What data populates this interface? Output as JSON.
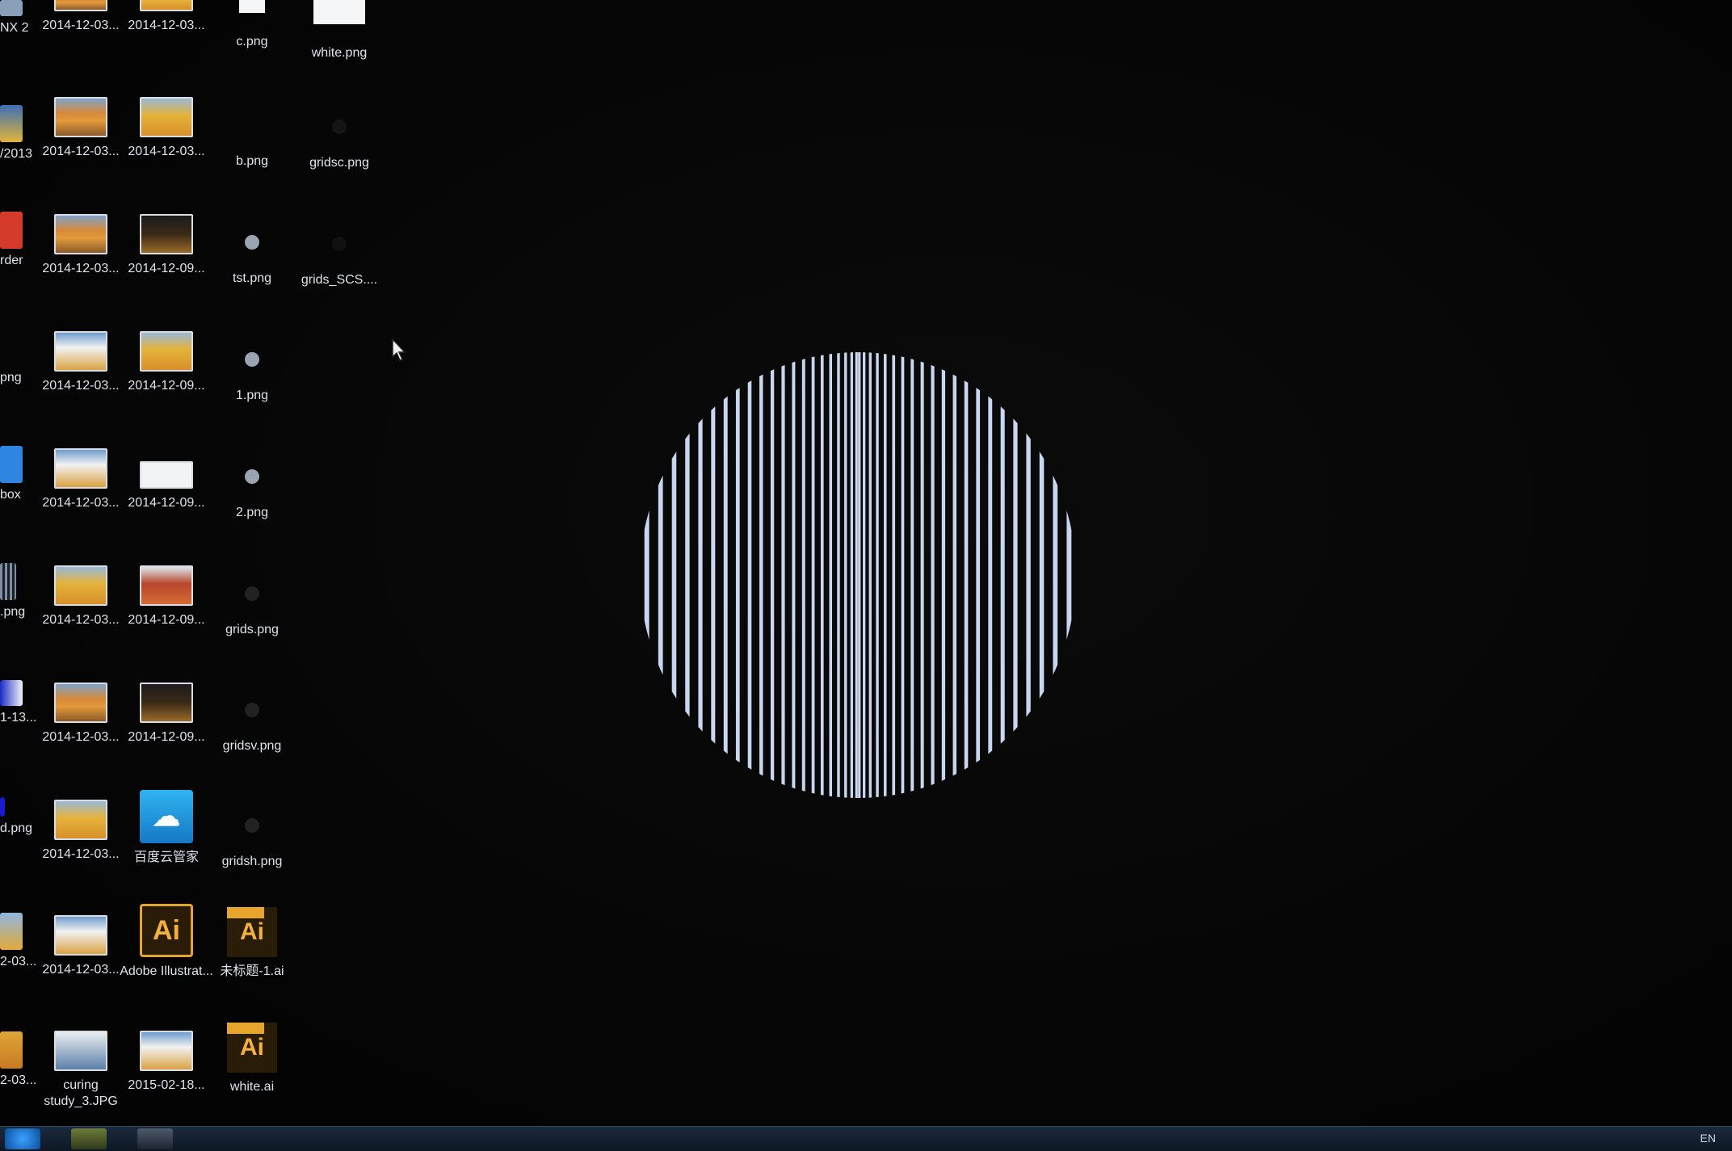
{
  "desktop": {
    "partial_column_labels": [
      "NX 2",
      "/2013",
      "rder",
      "png",
      "box",
      ".png",
      "1-13...",
      "d.png",
      "2-03...",
      "2-03..."
    ],
    "column1_labels": [
      "2014-12-03...",
      "2014-12-03...",
      "2014-12-03...",
      "2014-12-03...",
      "2014-12-03...",
      "2014-12-03...",
      "2014-12-03...",
      "2014-12-03...",
      "2014-12-03...",
      "curing study_3.JPG"
    ],
    "column2_labels": [
      "2014-12-03...",
      "2014-12-03...",
      "2014-12-09...",
      "2014-12-09...",
      "2014-12-09...",
      "2014-12-09...",
      "2014-12-09...",
      "百度云管家",
      "Adobe Illustrat...",
      "2015-02-18..."
    ],
    "column3_labels": [
      "c.png",
      "b.png",
      "tst.png",
      "1.png",
      "2.png",
      "grids.png",
      "gridsv.png",
      "gridsh.png",
      "未标题-1.ai",
      "white.ai"
    ],
    "column4_labels": [
      "white.png",
      "gridsc.png",
      "grids_SCS...."
    ],
    "app_tile_text": "Ai"
  },
  "stimulus": {
    "stripe_color": "#c9d6f0",
    "stripe_count": 42
  },
  "taskbar": {
    "tray_text": "EN"
  }
}
